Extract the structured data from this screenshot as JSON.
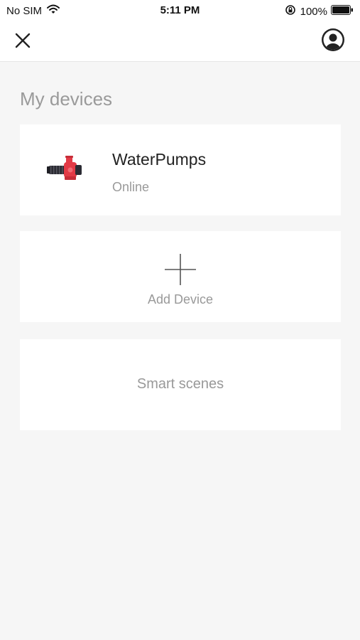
{
  "status_bar": {
    "carrier": "No SIM",
    "time": "5:11 PM",
    "battery_percent": "100%",
    "icons": [
      "wifi-icon",
      "orientation-lock-icon",
      "battery-icon"
    ]
  },
  "nav": {
    "close_icon": "close-icon",
    "profile_icon": "user-avatar-icon"
  },
  "section": {
    "title": "My devices"
  },
  "devices": [
    {
      "name": "WaterPumps",
      "status": "Online",
      "icon": "water-pump-image"
    }
  ],
  "add_device": {
    "label": "Add Device",
    "icon": "plus-icon"
  },
  "smart_scenes": {
    "label": "Smart scenes"
  },
  "colors": {
    "background": "#f6f6f6",
    "card": "#ffffff",
    "muted_text": "#9a9a9a",
    "pump_red": "#e23a46"
  }
}
